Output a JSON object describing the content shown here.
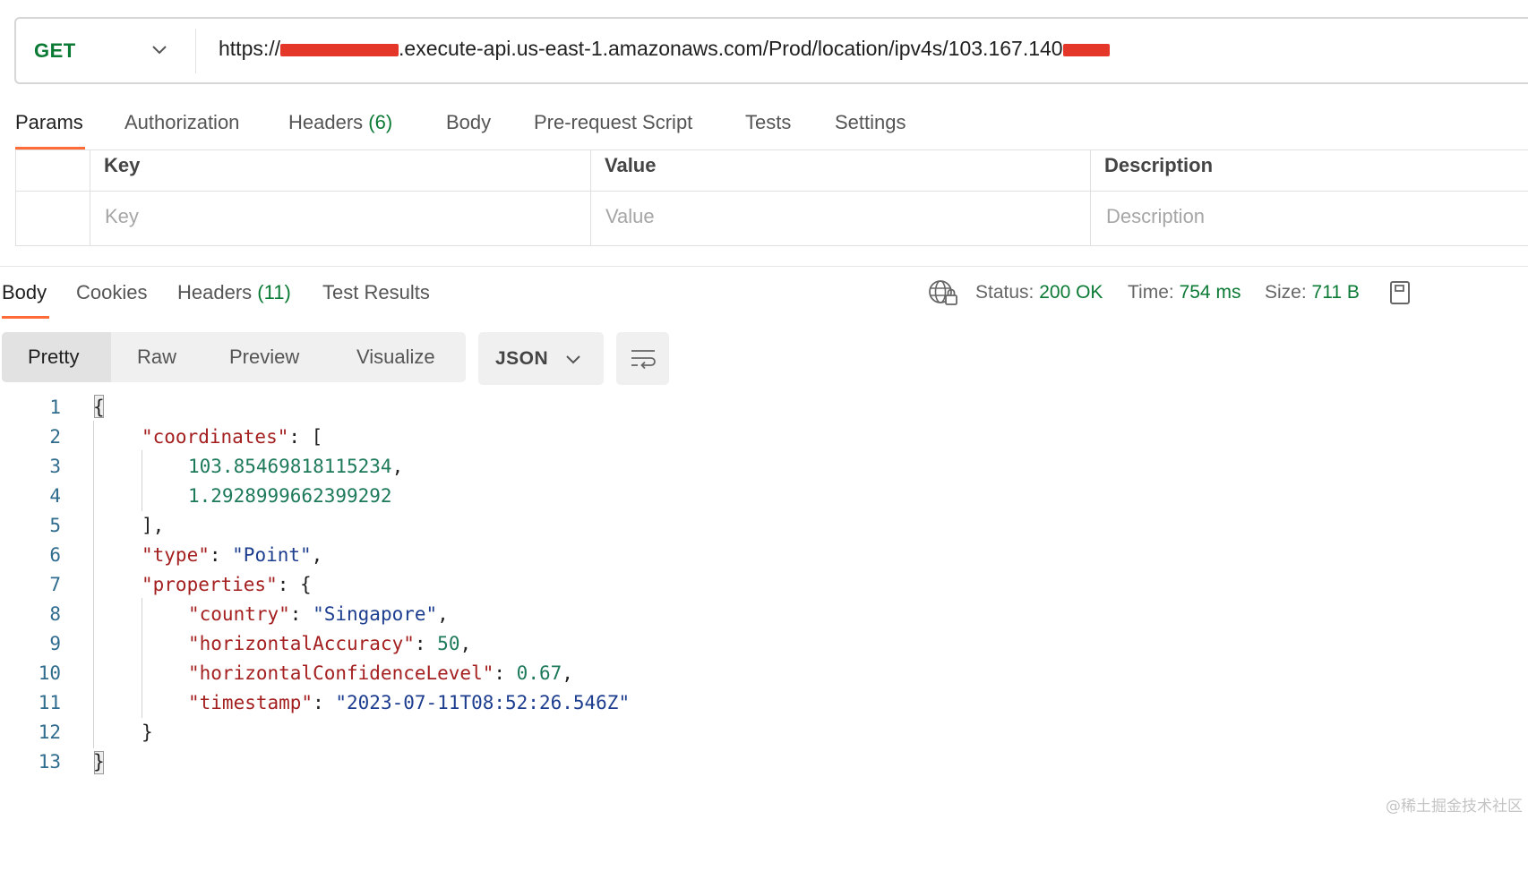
{
  "request": {
    "method": "GET",
    "url_prefix": "https://",
    "url_middle": ".execute-api.us-east-1.amazonaws.com/Prod/location/ipv4s/103.167.140",
    "redact_color": "#e5362a"
  },
  "request_tabs": [
    {
      "label": "Params",
      "count": ""
    },
    {
      "label": "Authorization",
      "count": ""
    },
    {
      "label": "Headers",
      "count": "(6)"
    },
    {
      "label": "Body",
      "count": ""
    },
    {
      "label": "Pre-request Script",
      "count": ""
    },
    {
      "label": "Tests",
      "count": ""
    },
    {
      "label": "Settings",
      "count": ""
    }
  ],
  "params_table": {
    "headers": [
      "Key",
      "Value",
      "Description"
    ],
    "placeholders": [
      "Key",
      "Value",
      "Description"
    ]
  },
  "response_tabs": [
    {
      "label": "Body",
      "count": ""
    },
    {
      "label": "Cookies",
      "count": ""
    },
    {
      "label": "Headers",
      "count": "(11)"
    },
    {
      "label": "Test Results",
      "count": ""
    }
  ],
  "status": {
    "status_label": "Status:",
    "status_value": "200 OK",
    "time_label": "Time:",
    "time_value": "754 ms",
    "size_label": "Size:",
    "size_value": "711 B"
  },
  "view_modes": [
    "Pretty",
    "Raw",
    "Preview",
    "Visualize"
  ],
  "format": "JSON",
  "code": {
    "line_numbers": [
      "1",
      "2",
      "3",
      "4",
      "5",
      "6",
      "7",
      "8",
      "9",
      "10",
      "11",
      "12",
      "13"
    ],
    "open_brace": "{",
    "coordinates_key": "\"coordinates\"",
    "colon_bracket": ": [",
    "coord_1": "103.85469818115234",
    "comma": ",",
    "coord_2": "1.2928999662399292",
    "close_bracket": "],",
    "type_key": "\"type\"",
    "colon": ": ",
    "type_value": "\"Point\"",
    "properties_key": "\"properties\"",
    "colon_brace": ": {",
    "country_key": "\"country\"",
    "country_value": "\"Singapore\"",
    "hacc_key": "\"horizontalAccuracy\"",
    "hacc_value": "50",
    "hconf_key": "\"horizontalConfidenceLevel\"",
    "hconf_value": "0.67",
    "ts_key": "\"timestamp\"",
    "ts_value": "\"2023-07-11T08:52:26.546Z\"",
    "inner_close": "}",
    "close_brace": "}"
  },
  "watermark": "@稀土掘金技术社区",
  "accent_color": "#ff6c37",
  "success_color": "#0b7a35"
}
